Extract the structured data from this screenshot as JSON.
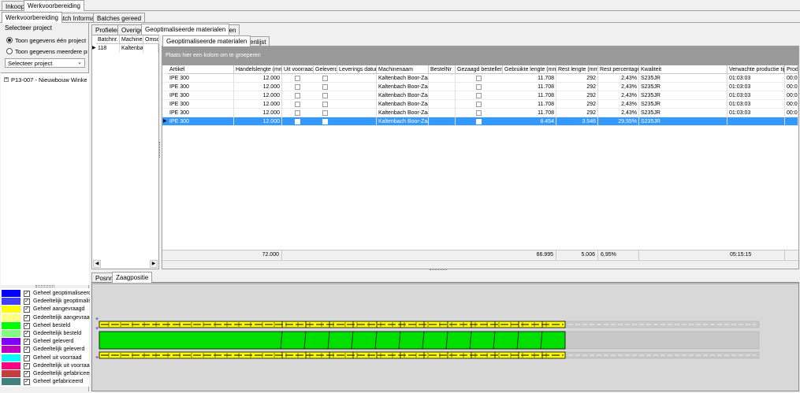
{
  "top_tabs": [
    "Inkoop",
    "Werkvoorbereiding"
  ],
  "sub_tabs": [
    "Werkvoorbereiding",
    "Batch Informatie",
    "Batches gereed"
  ],
  "left": {
    "group_title": "Selecteer project",
    "radio_one": "Toon gegevens één project",
    "radio_many": "Toon gegevens meerdere proje",
    "select_placeholder": "Selecteer project",
    "tree_item": "P13-007 - Nieuwbouw Winkelcent"
  },
  "inner_tabs": [
    "Profielen",
    "Overige",
    "Geoptimaliseerde materialen",
    "Bijlagen"
  ],
  "batch_grid": {
    "headers": [
      "Batchnr.",
      "Machinen",
      "Omsd"
    ],
    "row": [
      "118",
      "Kaltenbac",
      ""
    ]
  },
  "result_tabs": [
    "Geoptimaliseerde materialen",
    "Foutenlijst"
  ],
  "group_hint": "Plaats hier een kolom om te groeperen",
  "columns": [
    "Artikel",
    "Handelslengte (mm)",
    "Uit voorraad",
    "Geleverd",
    "Leverings datum",
    "Machinenaam",
    "BestelNr",
    "Gezaagd bestellen",
    "Gebruikte lengte (mm)",
    "Rest lengte (mm)",
    "Rest percentage",
    "Kwaliteit",
    "Verwachte productie tijd",
    "Produ"
  ],
  "rows": [
    {
      "artikel": "IPE 300",
      "handel": "12.000",
      "machine": "Kaltenbach Boor-Zaag",
      "gebruikt": "11.708",
      "rest": "292",
      "pct": "2,43%",
      "kwal": "S235JR",
      "tijd": "01:03:03",
      "prod": "00:00"
    },
    {
      "artikel": "IPE 300",
      "handel": "12.000",
      "machine": "Kaltenbach Boor-Zaag",
      "gebruikt": "11.708",
      "rest": "292",
      "pct": "2,43%",
      "kwal": "S235JR",
      "tijd": "01:03:03",
      "prod": "00:00"
    },
    {
      "artikel": "IPE 300",
      "handel": "12.000",
      "machine": "Kaltenbach Boor-Zaag",
      "gebruikt": "11.708",
      "rest": "292",
      "pct": "2,43%",
      "kwal": "S235JR",
      "tijd": "01:03:03",
      "prod": "00:00"
    },
    {
      "artikel": "IPE 300",
      "handel": "12.000",
      "machine": "Kaltenbach Boor-Zaag",
      "gebruikt": "11.708",
      "rest": "292",
      "pct": "2,43%",
      "kwal": "S235JR",
      "tijd": "01:03:03",
      "prod": "00:00"
    },
    {
      "artikel": "IPE 300",
      "handel": "12.000",
      "machine": "Kaltenbach Boor-Zaag",
      "gebruikt": "11.708",
      "rest": "292",
      "pct": "2,43%",
      "kwal": "S235JR",
      "tijd": "01:03:03",
      "prod": "00:00"
    },
    {
      "artikel": "IPE 300",
      "handel": "12.000",
      "machine": "Kaltenbach Boor-Zaag",
      "gebruikt": "8.454",
      "rest": "3.546",
      "pct": "29,55%",
      "kwal": "S235JR",
      "tijd": "",
      "prod": ""
    }
  ],
  "footer": {
    "handel": "72.000",
    "gebruikt": "66.995",
    "rest": "5.006",
    "pct": "6,95%",
    "tijd": "05:15:15"
  },
  "bottom_tabs": [
    "Posnr.",
    "Zaagpositie"
  ],
  "legend": [
    {
      "color": "#0000ff",
      "label": "Geheel geoptimaliseerd"
    },
    {
      "color": "#4040ff",
      "label": "Gedeeltelijk geoptimaliseerd"
    },
    {
      "color": "#ffff00",
      "label": "Geheel aangevraagd"
    },
    {
      "color": "#ffff80",
      "label": "Gedeeltelijk aangevraagd"
    },
    {
      "color": "#00ff00",
      "label": "Geheel besteld"
    },
    {
      "color": "#80ff80",
      "label": "Gedeeltelijk besteld"
    },
    {
      "color": "#8000ff",
      "label": "Geheel geleverd"
    },
    {
      "color": "#c000c0",
      "label": "Gedeeltelijk geleverd"
    },
    {
      "color": "#00ffff",
      "label": "Geheel uit voorraad"
    },
    {
      "color": "#ff0080",
      "label": "Gedeeltelijk uit voorraad"
    },
    {
      "color": "#c04040",
      "label": "Gedeeltelijk gefabriceerd"
    },
    {
      "color": "#408080",
      "label": "Geheel gefabriceerd"
    }
  ],
  "colors": {
    "selected_row": "#3399ff",
    "group_bar": "#9a9a9a",
    "saw_yellow": "#ffff00",
    "saw_green": "#00e000"
  }
}
